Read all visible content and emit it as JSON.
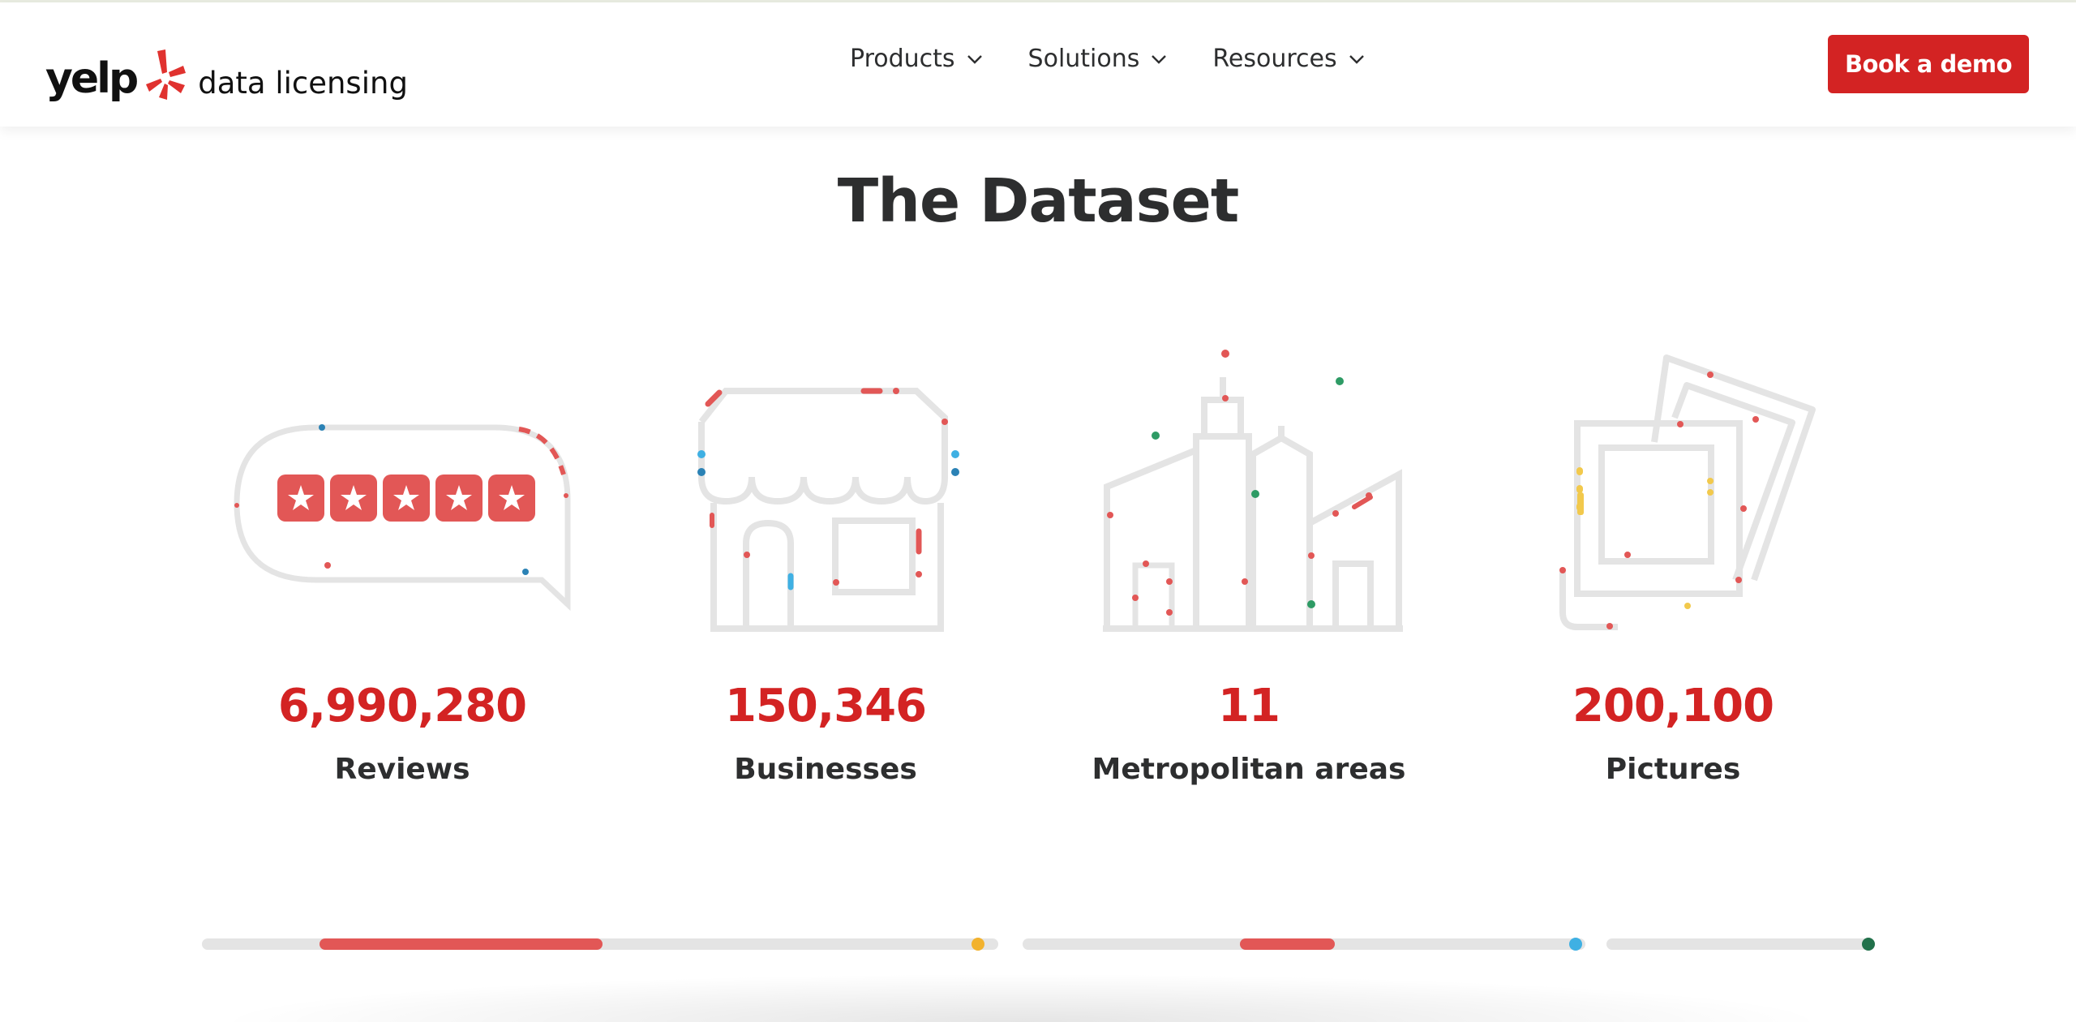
{
  "brand": {
    "logo_word": "yelp",
    "logo_subtitle": "data licensing",
    "accent": "#d32323"
  },
  "nav": {
    "items": [
      {
        "label": "Products",
        "icon": "chevron-down-icon"
      },
      {
        "label": "Solutions",
        "icon": "chevron-down-icon"
      },
      {
        "label": "Resources",
        "icon": "chevron-down-icon"
      }
    ],
    "cta_label": "Book a demo"
  },
  "section": {
    "title": "The Dataset"
  },
  "stats": [
    {
      "value": "6,990,280",
      "label": "Reviews",
      "icon": "review-bubble-icon"
    },
    {
      "value": "150,346",
      "label": "Businesses",
      "icon": "storefront-icon"
    },
    {
      "value": "11",
      "label": "Metropolitan areas",
      "icon": "city-skyline-icon"
    },
    {
      "value": "200,100",
      "label": "Pictures",
      "icon": "photos-icon"
    }
  ],
  "progress_tracks": [
    {
      "fill_start": 0.15,
      "fill_end": 0.5,
      "dot_color": "#f2b22e"
    },
    {
      "fill_start": 0.39,
      "fill_end": 0.55,
      "dot_color": "#3fb0e3"
    },
    {
      "fill_start": 0.0,
      "fill_end": 0.0,
      "dot_color": "#22714b"
    }
  ],
  "colors": {
    "text": "#2d2e2f",
    "icon_line": "#e2e2e2",
    "icon_red": "#e25756",
    "icon_blue": "#3fb0e3",
    "icon_green": "#2e9b65",
    "icon_yellow": "#f2c94c"
  }
}
